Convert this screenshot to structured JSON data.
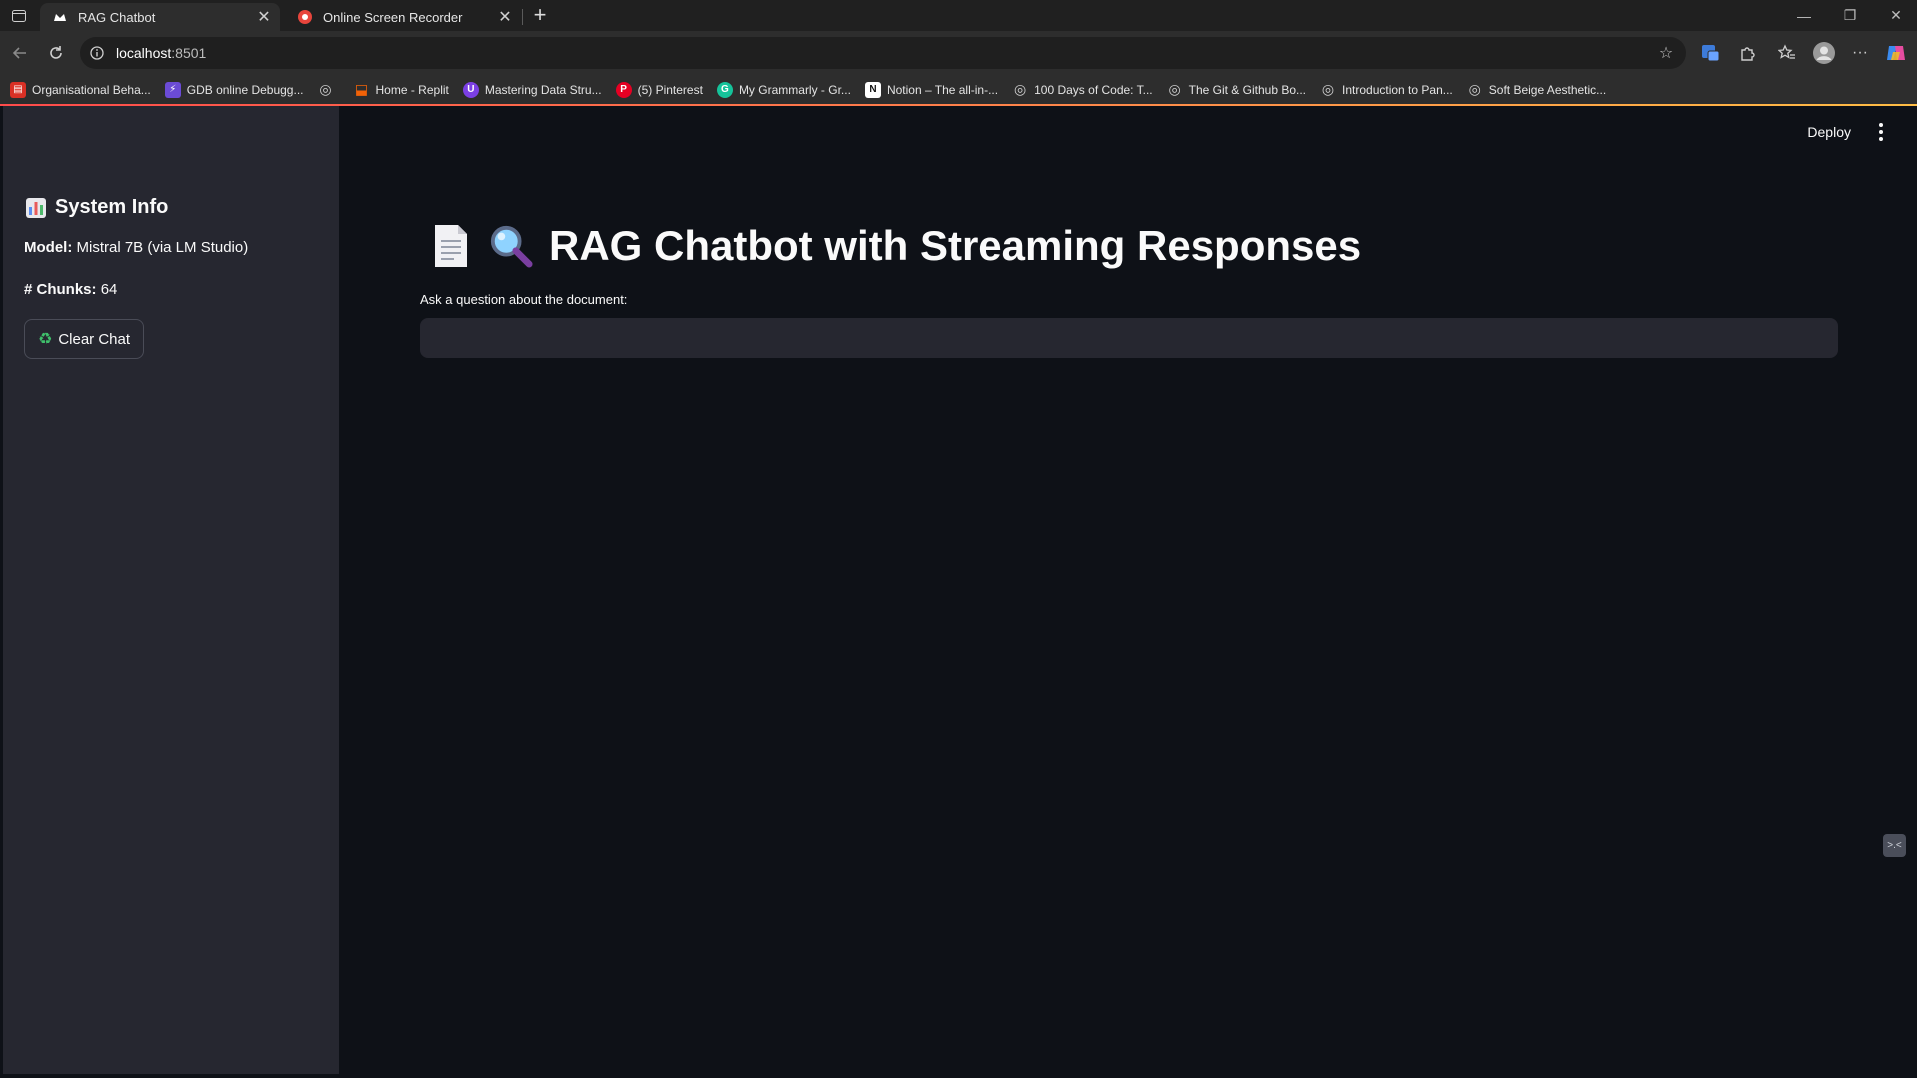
{
  "browser": {
    "tabs": [
      {
        "title": "RAG Chatbot",
        "icon": "streamlit-crown-icon",
        "active": true
      },
      {
        "title": "Online Screen Recorder",
        "icon": "record-icon",
        "active": false
      }
    ],
    "url_host": "localhost",
    "url_port": ":8501",
    "bookmarks": [
      {
        "label": "Organisational Beha...",
        "icon": "pdf-icon",
        "color": "#d93025"
      },
      {
        "label": "GDB online Debugg...",
        "icon": "bolt-icon",
        "color": "#6b4bd6"
      },
      {
        "label": "",
        "icon": "globe-icon",
        "color": ""
      },
      {
        "label": "Home - Replit",
        "icon": "replit-icon",
        "color": "#f26207"
      },
      {
        "label": "Mastering Data Stru...",
        "icon": "shield-icon",
        "color": "#7b3fe4"
      },
      {
        "label": "(5) Pinterest",
        "icon": "pinterest-icon",
        "color": "#e60023"
      },
      {
        "label": "My Grammarly - Gr...",
        "icon": "grammarly-icon",
        "color": "#15c39a"
      },
      {
        "label": "Notion – The all-in-...",
        "icon": "notion-icon",
        "color": "#ffffff"
      },
      {
        "label": "100 Days of Code: T...",
        "icon": "globe-icon",
        "color": ""
      },
      {
        "label": "The Git & Github Bo...",
        "icon": "globe-icon",
        "color": ""
      },
      {
        "label": "Introduction to Pan...",
        "icon": "globe-icon",
        "color": ""
      },
      {
        "label": "Soft Beige Aesthetic...",
        "icon": "globe-icon",
        "color": ""
      }
    ]
  },
  "app": {
    "deploy_label": "Deploy",
    "sidebar": {
      "title": "System Info",
      "model_label": "Model:",
      "model_value": "Mistral 7B (via LM Studio)",
      "chunks_label": "# Chunks:",
      "chunks_value": "64",
      "clear_button": "Clear Chat"
    },
    "main": {
      "title": "RAG Chatbot with Streaming Responses",
      "input_label": "Ask a question about the document:",
      "input_value": ""
    },
    "colors": {
      "main_bg": "#0e1117",
      "sidebar_bg": "#262730",
      "input_bg": "#262730",
      "accent": "#ff4b4b"
    }
  }
}
